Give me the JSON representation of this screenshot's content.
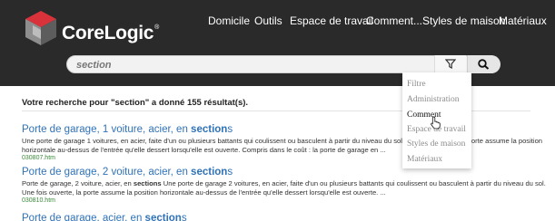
{
  "brand": {
    "name_part1": "Core",
    "name_part2": "Logic",
    "trademark": "®"
  },
  "nav": [
    {
      "label": "Domicile"
    },
    {
      "label": "Outils"
    },
    {
      "label": "Espace de travail"
    },
    {
      "label": "Comment..."
    },
    {
      "label": "Styles de maison"
    },
    {
      "label": "Matériaux"
    }
  ],
  "search": {
    "value": "section"
  },
  "filter_dropdown": {
    "items": [
      {
        "label": "Filtre"
      },
      {
        "label": "Administration"
      },
      {
        "label": "Comment"
      },
      {
        "label": "Espace de travail"
      },
      {
        "label": "Styles de maison"
      },
      {
        "label": "Matériaux"
      }
    ],
    "active": "Comment"
  },
  "summary": "Votre recherche pour \"section\" a donné 155 résultat(s).",
  "results": [
    {
      "title_pre": "Porte de garage, 1 voiture, acier, en ",
      "title_bold": "section",
      "title_post": "s",
      "desc_pre": "Une porte de garage 1 voitures, en acier, faite d'un ou plusieurs battants qui coulissent ou basculent à partir du niveau du sol. Une fois ouverte, la porte assume la position horizontale au-dessus de l'entrée qu'elle dessert lorsqu'elle est ouverte. Compris dans le coût : la porte de garage en ...",
      "desc_bold": "",
      "desc_post": "",
      "url": "030807.htm"
    },
    {
      "title_pre": "Porte de garage, 2 voiture, acier, en ",
      "title_bold": "section",
      "title_post": "s",
      "desc_pre": "Porte de garage, 2 voiture, acier, en ",
      "desc_bold": "sections",
      "desc_post": " Une porte de garage 2 voitures, en acier, faite d'un ou plusieurs battants qui coulissent ou basculent à partir du niveau du sol. Une fois ouverte, la porte assume la position horizontale au-dessus de l'entrée qu'elle dessert lorsqu'elle est ouverte. ...",
      "url": "030810.htm"
    },
    {
      "title_pre": "Porte de garage, acier, en ",
      "title_bold": "section",
      "title_post": "s"
    }
  ]
}
